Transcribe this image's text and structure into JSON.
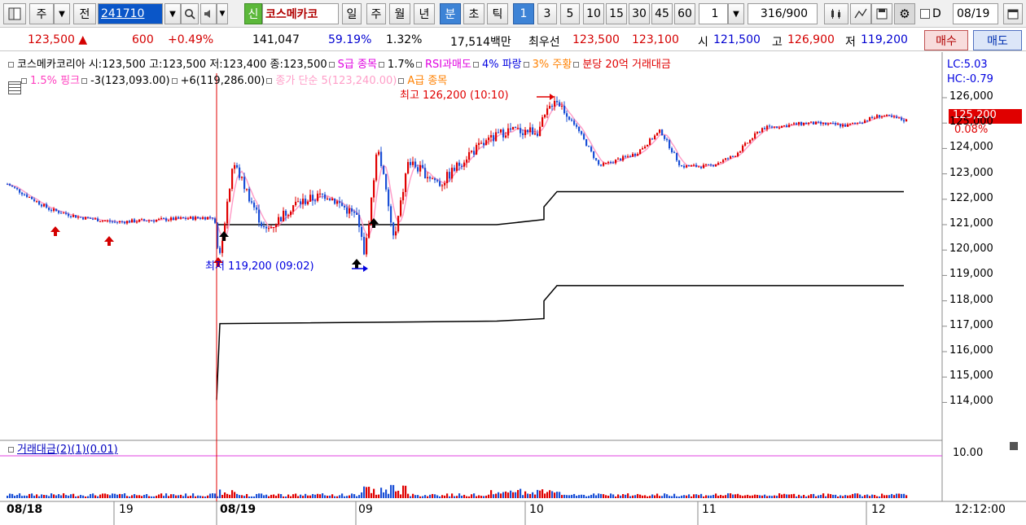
{
  "toolbar": {
    "mode_ju": "주",
    "mode_jeon": "전",
    "code": "241710",
    "stock_name": "코스메카코",
    "shin": "신",
    "periods": [
      "일",
      "주",
      "월",
      "년",
      "분",
      "초",
      "틱"
    ],
    "minute_buttons": [
      "1",
      "3",
      "5",
      "10",
      "15",
      "30",
      "45",
      "60"
    ],
    "interval_value": "1",
    "count": "316",
    "count_total": "/900",
    "checkbox_d": "D",
    "date": "08/19"
  },
  "quote": {
    "price": "123,500",
    "change": "600",
    "change_pct": "+0.49%",
    "volume": "141,047",
    "ratio1": "59.19%",
    "ratio2": "1.32%",
    "amount": "17,514백만",
    "best_label": "최우선",
    "best_ask": "123,500",
    "best_bid": "123,100",
    "open_label": "시",
    "open": "121,500",
    "high_label": "고",
    "high": "126,900",
    "low_label": "저",
    "low": "119,200",
    "buy": "매수",
    "sell": "매도"
  },
  "legend": {
    "line1": [
      {
        "text": "코스메카코리아 시:123,500 고:123,500 저:123,400 종:123,500",
        "color": "#000000"
      },
      {
        "text": "S급 종목",
        "color": "#e000e0"
      },
      {
        "text": "1.7%",
        "color": "#000000"
      },
      {
        "text": "RSI과매도",
        "color": "#e000e0"
      },
      {
        "text": "4% 파랑",
        "color": "#0000e0"
      },
      {
        "text": "3% 주황",
        "color": "#ff8000"
      },
      {
        "text": "분당 20억 거래대금",
        "color": "#e00000"
      }
    ],
    "line2": [
      {
        "text": "1.5% 핑크",
        "color": "#ff40c0"
      },
      {
        "text": "-3(123,093.00)",
        "color": "#000000"
      },
      {
        "text": "+6(119,286.00)",
        "color": "#000000"
      },
      {
        "text": "종가 단순 5(123,240.00)",
        "color": "#ff9ec8"
      },
      {
        "text": "A급 종목",
        "color": "#ff8000"
      }
    ],
    "lc": "LC:5.03",
    "hc": "HC:-0.79"
  },
  "annotations": {
    "high": "최고 126,200 (10:10)",
    "low": "최저 119,200 (09:02)"
  },
  "price_axis": {
    "ticks": [
      "126,000",
      "125,000",
      "124,000",
      "123,000",
      "122,000",
      "121,000",
      "120,000",
      "119,000",
      "118,000",
      "117,000",
      "116,000",
      "115,000",
      "114,000"
    ],
    "current_price": "125,200",
    "current_pct": "0.08%"
  },
  "volume_panel": {
    "title": "거래대금(2)(1)(0.01)",
    "axis": "10.00"
  },
  "x_axis": {
    "labels": [
      "08/18",
      "19",
      "08/19",
      "09",
      "10",
      "11",
      "12"
    ],
    "time": "12:12:00"
  },
  "colors": {
    "up": "#e00000",
    "down": "#1a4fd6",
    "ma": "#ff9ec8"
  }
}
